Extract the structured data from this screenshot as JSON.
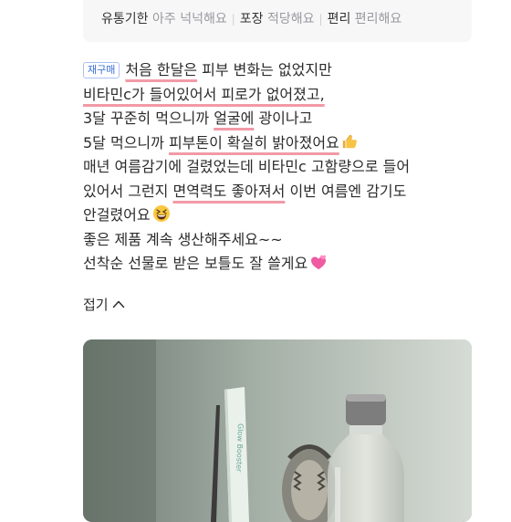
{
  "attributes": [
    {
      "key": "유통기한",
      "value": "아주 넉넉해요"
    },
    {
      "key": "포장",
      "value": "적당해요"
    },
    {
      "key": "편리",
      "value": "편리해요"
    }
  ],
  "review": {
    "badge": "재구매",
    "line1_hl": "처음 한달은",
    "line1_rest": " 피부 변화는 없었지만",
    "line2_hl": "비타민c가 들어있어서 피로가 없어졌고,",
    "line3_pre": "3달 꾸준히 먹으니까 ",
    "line3_hl": "얼굴에",
    "line3_post": " 광이나고",
    "line4_pre": "5달 먹으니까 ",
    "line4_hl": "피부톤이 확실히 밝아졌어요",
    "line5": "매년 여름감기에 걸렸었는데 비타민c 고함량으로 들어",
    "line6_pre": "있어서 그런지 ",
    "line6_hl": "면역력도 좋아져서",
    "line6_post": " 이번 여름엔 감기도",
    "line7": "안걸렸어요",
    "line8": "좋은 제품 계속 생산해주세요~~",
    "line9": "선착순 선물로 받은 보틀도 잘 쓸게요",
    "emojis": [
      "thumbs-up-icon",
      "grinning-squinting-face-icon",
      "two-hearts-icon"
    ]
  },
  "fold_label": "접기",
  "photo": {
    "stick_label": "Glow Booster",
    "colors": {
      "background": "#8f9a92",
      "highlight": "#f19aa6",
      "badge": "#3a6fd6"
    }
  }
}
